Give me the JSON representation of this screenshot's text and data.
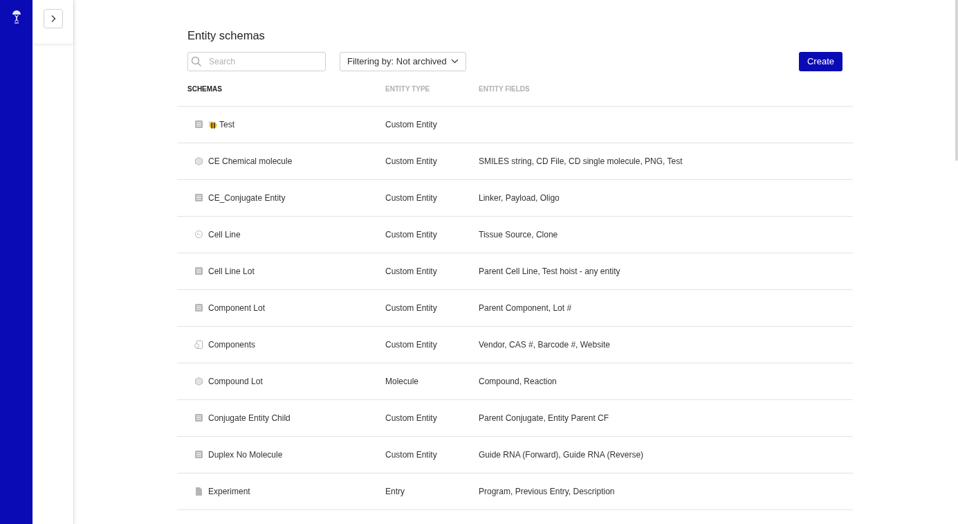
{
  "title": "Entity schemas",
  "search": {
    "placeholder": "Search"
  },
  "filter": {
    "label": "Filtering by: Not archived"
  },
  "create_button": "Create",
  "table": {
    "columns": [
      "SCHEMAS",
      "ENTITY TYPE",
      "ENTITY FIELDS"
    ],
    "rows": [
      {
        "kind": "tagged",
        "name": "Test",
        "type": "Custom Entity"
      },
      {
        "kind": "molecule",
        "name": "CE Chemical molecule",
        "type": "Custom Entity",
        "fields": "SMILES string, CD File, CD single molecule, PNG, Test"
      },
      {
        "kind": "custom",
        "name": "CE_Conjugate Entity",
        "type": "Custom Entity",
        "fields": "Linker, Payload, Oligo"
      },
      {
        "kind": "cell",
        "name": "Cell Line",
        "type": "Custom Entity",
        "fields": "Tissue Source, Clone"
      },
      {
        "kind": "custom",
        "name": "Cell Line Lot",
        "type": "Custom Entity",
        "fields": "Parent Cell Line, Test hoist - any entity"
      },
      {
        "kind": "custom",
        "name": "Component Lot",
        "type": "Custom Entity",
        "fields": "Parent Component, Lot #"
      },
      {
        "kind": "component",
        "name": "Components",
        "type": "Custom Entity",
        "fields": "Vendor, CAS #, Barcode #, Website"
      },
      {
        "kind": "molecule",
        "name": "Compound Lot",
        "type": "Molecule",
        "fields": "Compound, Reaction"
      },
      {
        "kind": "custom",
        "name": "Conjugate Entity Child",
        "type": "Custom Entity",
        "fields": "Parent Conjugate, Entity Parent CF"
      },
      {
        "kind": "custom",
        "name": "Duplex No Molecule",
        "type": "Custom Entity",
        "fields": "Guide RNA (Forward), Guide RNA (Reverse)"
      },
      {
        "kind": "entry",
        "name": "Experiment",
        "type": "Entry",
        "fields": "Program, Previous Entry, Description"
      }
    ]
  }
}
